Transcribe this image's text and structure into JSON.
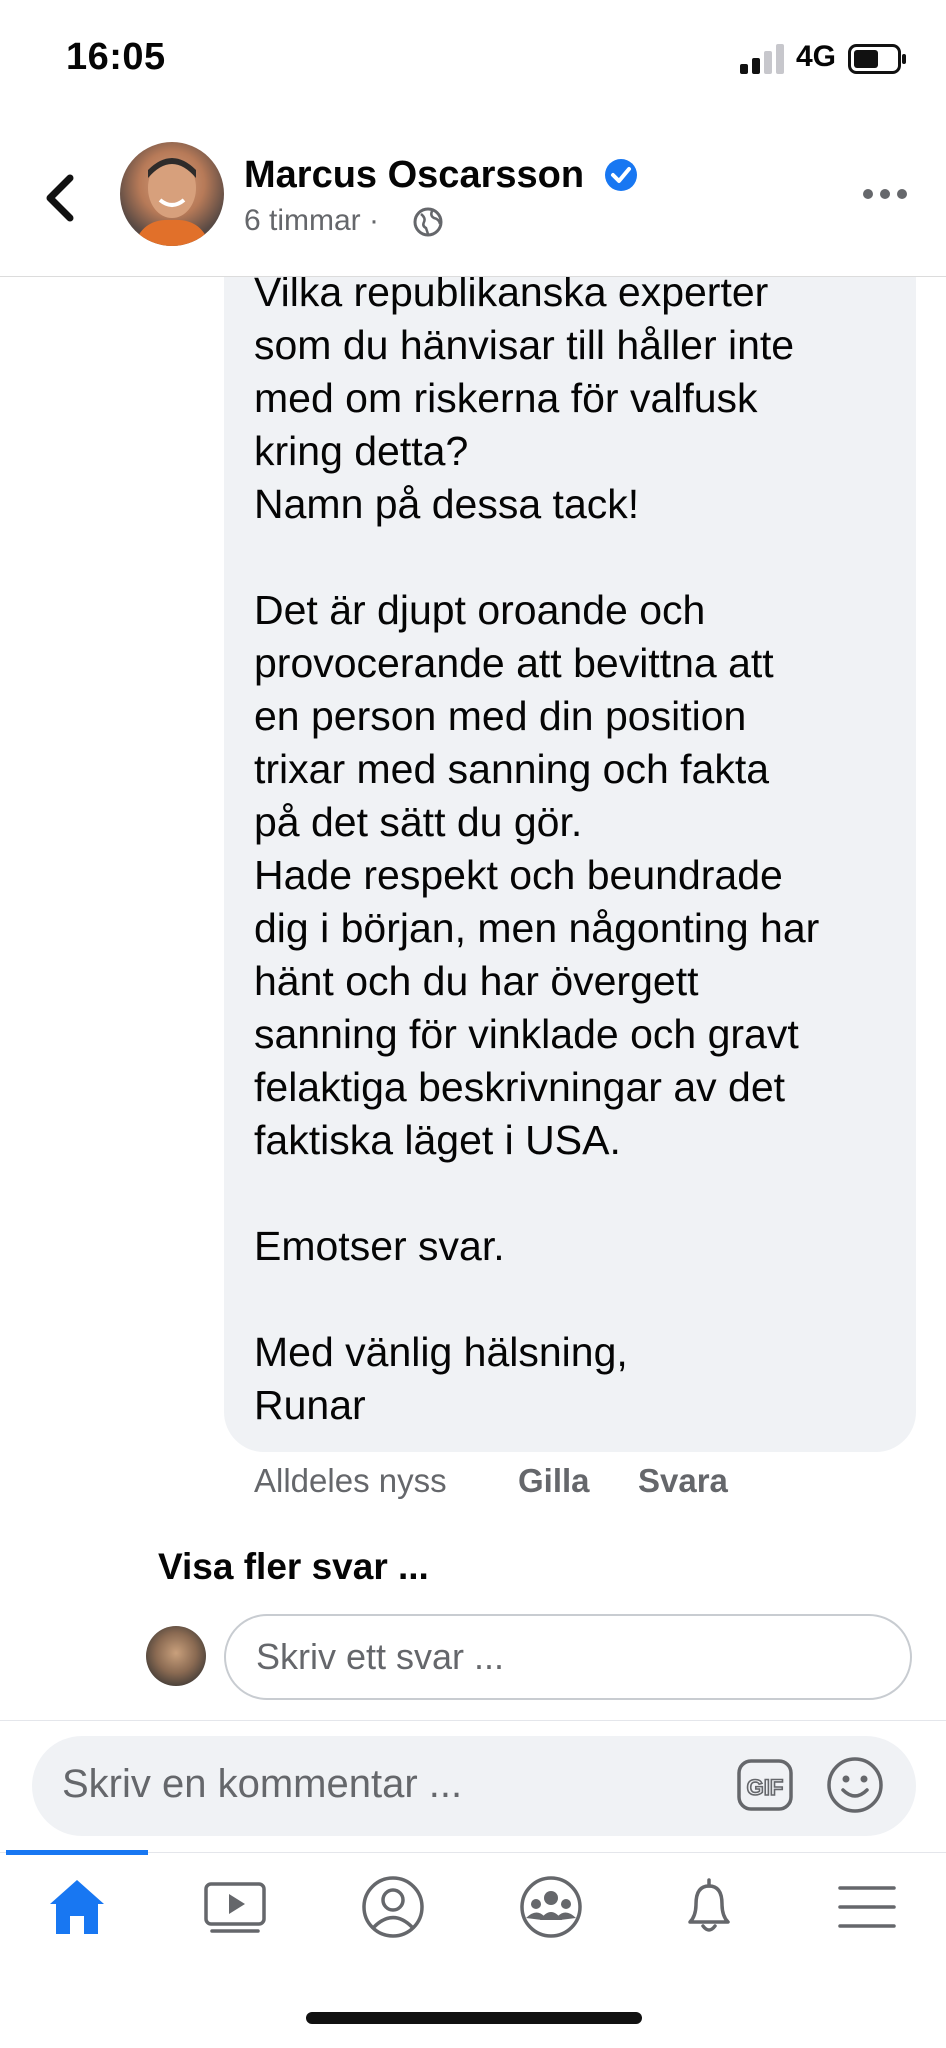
{
  "status_bar": {
    "time": "16:05",
    "network": "4G"
  },
  "header": {
    "name": "Marcus Oscarsson",
    "time_ago": "6 timmar ·",
    "back_icon": "chevron-left-icon",
    "more_icon": "more-horizontal-icon"
  },
  "comment": {
    "text": "Vilka republikanska experter\nsom du hänvisar till håller inte\nmed om riskerna för valfusk\nkring detta?\nNamn på dessa tack!\n\nDet är djupt oroande och\nprovocerande att bevittna att\nen person med din position\ntrixar med sanning och fakta\npå det sätt du gör.\nHade respekt och beundrade\ndig i början, men någonting har\nhänt och du har övergett\nsanning för vinklade och gravt\nfelaktiga beskrivningar av det\nfaktiska läget i USA.\n\nEmotser svar.\n\nMed vänlig hälsning,\nRunar",
    "time": "Alldeles nyss",
    "like_label": "Gilla",
    "reply_label": "Svara"
  },
  "more_replies": "Visa fler svar ...",
  "reply_input": {
    "placeholder": "Skriv ett svar ..."
  },
  "composer": {
    "placeholder": "Skriv en kommentar ...",
    "gif_label": "GIF"
  },
  "nav": {
    "items": [
      {
        "icon": "home-icon",
        "active": true
      },
      {
        "icon": "video-icon",
        "active": false
      },
      {
        "icon": "profile-icon",
        "active": false
      },
      {
        "icon": "groups-icon",
        "active": false
      },
      {
        "icon": "bell-icon",
        "active": false
      },
      {
        "icon": "menu-icon",
        "active": false
      }
    ]
  },
  "colors": {
    "accent": "#1877f2",
    "secondary_text": "#65676b",
    "bubble": "#f0f2f5"
  }
}
